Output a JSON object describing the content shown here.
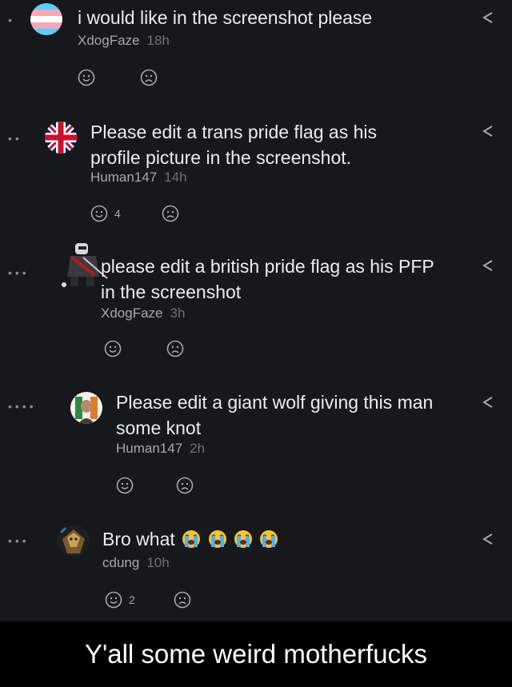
{
  "comments": [
    {
      "text": "i would like in the screenshot please",
      "user": "XdogFaze",
      "time": "18h",
      "likes": ""
    },
    {
      "text": "Please edit a trans pride flag as his profile picture in the screenshot.",
      "user": "Human147",
      "time": "14h",
      "likes": "4"
    },
    {
      "text": "please edit a british pride flag as his PFP in the screenshot",
      "user": "XdogFaze",
      "time": "3h",
      "likes": ""
    },
    {
      "text": "Please edit a giant wolf giving this man some knot",
      "user": "Human147",
      "time": "2h",
      "likes": ""
    },
    {
      "text": "Bro what",
      "user": "cdung",
      "time": "10h",
      "likes": "2"
    }
  ],
  "icons": {
    "reply": "reply-arrow-icon",
    "like": "smiley-face-icon",
    "dislike": "frowning-face-icon",
    "crying": "loudly-crying-face-icon"
  },
  "colors": {
    "background": "#17181c",
    "trans_blue": "#5bcefa",
    "trans_pink": "#f5a9b8",
    "uk_blue": "#012169",
    "uk_red": "#c8102e"
  },
  "caption": "Y'all some weird motherfucks"
}
